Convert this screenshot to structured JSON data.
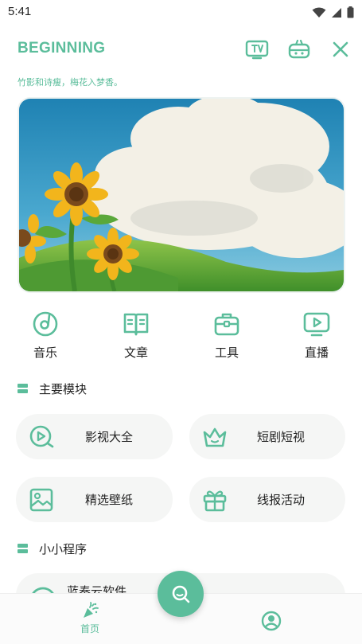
{
  "status_bar": {
    "time": "5:41"
  },
  "header": {
    "title": "BEGINNING",
    "subtitle": "竹影和诗瘦，梅花入梦香。",
    "buttons": [
      "tv-icon",
      "robot-icon",
      "close-icon"
    ]
  },
  "banner": {
    "description_icon": "sunflower-landscape-image"
  },
  "quick_nav": [
    {
      "label": "音乐",
      "icon": "music-disc-icon"
    },
    {
      "label": "文章",
      "icon": "book-icon"
    },
    {
      "label": "工具",
      "icon": "toolbox-icon"
    },
    {
      "label": "直播",
      "icon": "live-play-icon"
    }
  ],
  "main_section": {
    "title": "主要模块",
    "cards": [
      {
        "label": "影视大全",
        "icon": "video-play-icon"
      },
      {
        "label": "短剧短视",
        "icon": "crown-icon"
      },
      {
        "label": "精选壁纸",
        "icon": "image-icon"
      },
      {
        "label": "线报活动",
        "icon": "gift-icon"
      }
    ]
  },
  "mini_section": {
    "title": "小小程序",
    "items": [
      {
        "label": "蓝奏云软件",
        "icon": "cloud-icon"
      }
    ]
  },
  "bottom_nav": {
    "home_label": "首页",
    "items": [
      "party-popper-icon",
      "profile-icon"
    ]
  },
  "fab": {
    "icon": "search-icon"
  },
  "colors": {
    "accent": "#5bbd9b",
    "card_bg": "#f5f6f5"
  }
}
